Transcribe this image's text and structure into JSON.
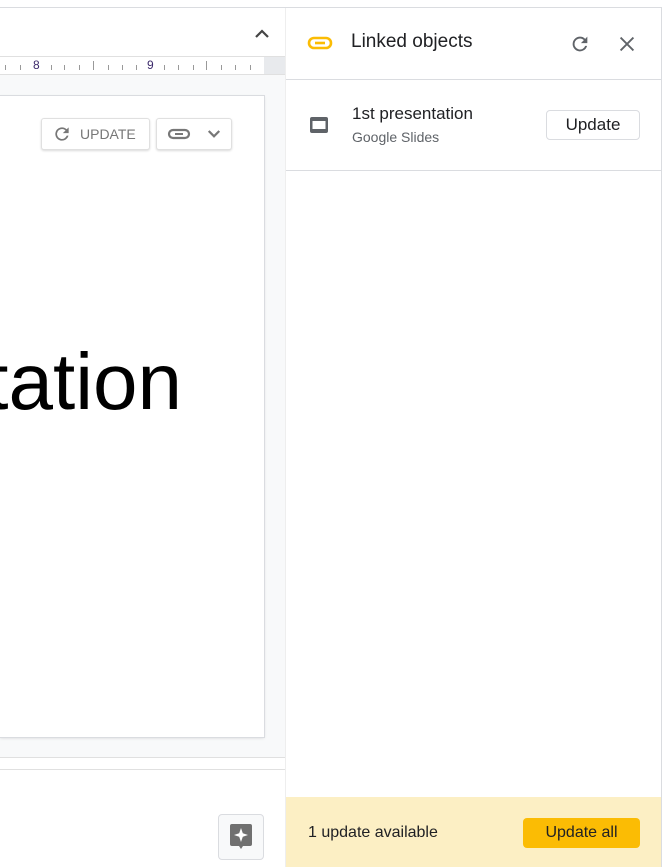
{
  "ruler": {
    "labels": [
      "8",
      "9"
    ]
  },
  "document": {
    "visible_text": "tation",
    "embed_update_label": "UPDATE"
  },
  "panel": {
    "title": "Linked objects",
    "accent": "#fbbc04",
    "items": [
      {
        "title": "1st presentation",
        "source": "Google Slides",
        "update_label": "Update"
      }
    ],
    "footer": {
      "status": "1 update available",
      "update_all_label": "Update all",
      "background": "#fcefc4"
    }
  }
}
